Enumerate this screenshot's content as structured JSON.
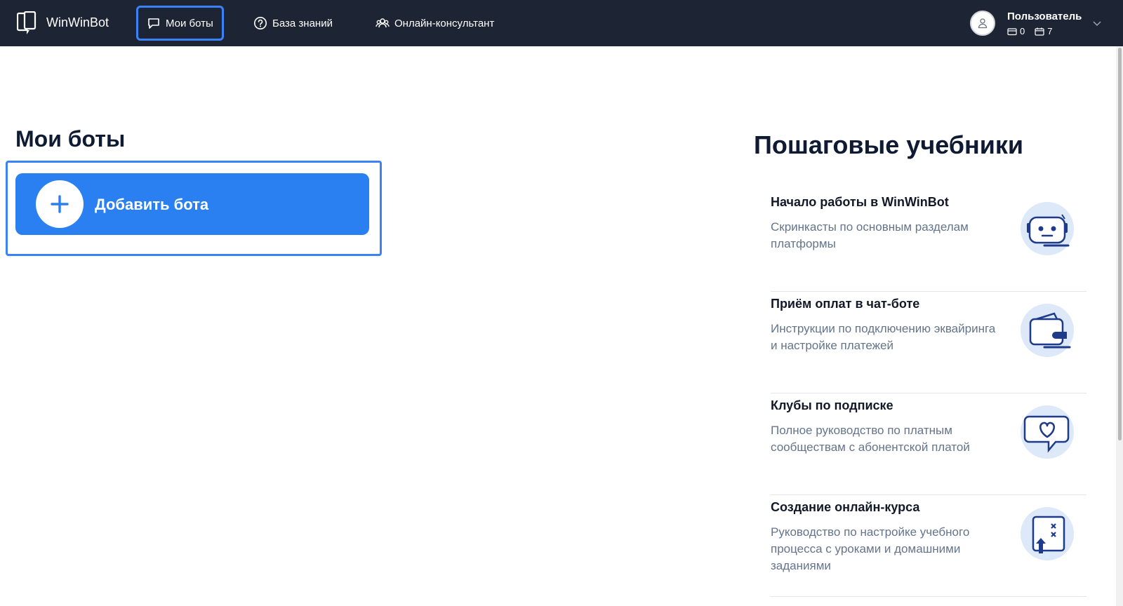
{
  "header": {
    "brand": "WinWinBot",
    "nav": [
      {
        "label": "Мои боты",
        "icon": "chat-bubble-icon",
        "active": true
      },
      {
        "label": "База знаний",
        "icon": "help-circle-icon",
        "active": false
      },
      {
        "label": "Онлайн-консультант",
        "icon": "users-icon",
        "active": false
      }
    ],
    "user": {
      "name": "Пользователь",
      "stat1": "0",
      "stat2": "7"
    }
  },
  "left": {
    "title": "Мои боты",
    "add_button_label": "Добавить бота"
  },
  "right": {
    "title": "Пошаговые учебники",
    "tutorials": [
      {
        "title": "Начало работы в WinWinBot",
        "desc": "Скринкасты по основным разделам платформы",
        "icon": "robot-icon"
      },
      {
        "title": "Приём оплат в чат-боте",
        "desc": "Инструкции по подключению эквайринга и настройке платежей",
        "icon": "wallet-icon"
      },
      {
        "title": "Клубы по подписке",
        "desc": "Полное руководство по платным сообществам с абонентской платой",
        "icon": "heart-chat-icon"
      },
      {
        "title": "Создание онлайн-курса",
        "desc": "Руководство по настройке учебного процесса с уроками и домашними заданиями",
        "icon": "course-board-icon"
      }
    ]
  },
  "colors": {
    "topbar": "#1d2433",
    "accent": "#2a7ff1",
    "focus": "#3b82f6"
  }
}
